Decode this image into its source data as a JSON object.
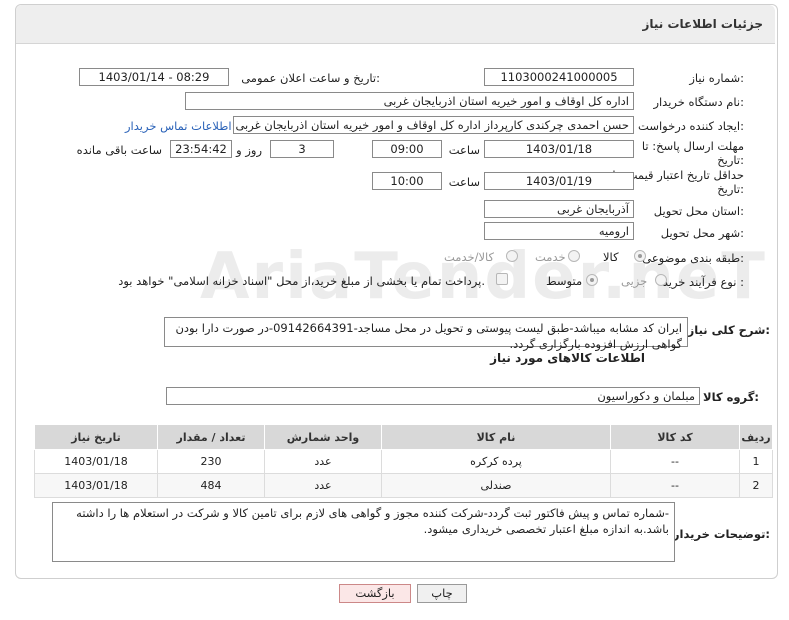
{
  "header": {
    "title": "جزئیات اطلاعات نیاز"
  },
  "fields": {
    "need_number_label": "شماره نیاز:",
    "need_number": "1103000241000005",
    "announce_label": "تاریخ و ساعت اعلان عمومی:",
    "announce_value": "1403/01/14 - 08:29",
    "buyer_org_label": "نام دستگاه خریدار:",
    "buyer_org": "اداره کل اوقاف و امور خیریه استان اذربایجان غربی",
    "creator_label": "ایجاد کننده درخواست:",
    "creator": "حسن احمدی چرکندی کارپرداز اداره کل اوقاف و امور خیریه استان اذربایجان غربی",
    "contact_link": "اطلاعات تماس خریدار",
    "deadline_label_1": "مهلت ارسال پاسخ: تا",
    "deadline_label_2": "تاریخ:",
    "deadline_date": "1403/01/18",
    "time_label": "ساعت",
    "deadline_time": "09:00",
    "days_value": "3",
    "days_label": "روز و",
    "remaining_value": "23:54:42",
    "remaining_label": "ساعت باقی مانده",
    "validity_label_1": "حداقل تاریخ اعتبار قیمت: تا",
    "validity_label_2": "تاریخ:",
    "validity_date": "1403/01/19",
    "validity_time": "10:00",
    "province_label": "استان محل تحویل:",
    "province": "آذربایجان غربی",
    "city_label": "شهر محل تحویل:",
    "city": "ارومیه",
    "category_label": "طبقه بندی موضوعی:",
    "category_options": [
      "کالا",
      "خدمت",
      "کالا/خدمت"
    ],
    "process_label": "نوع فرآیند خرید :",
    "process_options": [
      "جزیی",
      "متوسط"
    ],
    "payment_note": "پرداخت تمام یا بخشی از مبلغ خرید،از محل \"اسناد خزانه اسلامی\" خواهد بود."
  },
  "description": {
    "label": "شرح کلی نیاز:",
    "text": "ایران کد مشابه میباشد-طبق لیست پیوستی و تحویل در محل مساجد-09142664391-در صورت دارا بودن گواهی ارزش افزوده بارگزاری گردد."
  },
  "goods": {
    "section_title": "اطلاعات کالاهای مورد نیاز",
    "group_label": "گروه کالا:",
    "group_value": "مبلمان و دکوراسیون",
    "columns": [
      "ردیف",
      "کد کالا",
      "نام کالا",
      "واحد شمارش",
      "تعداد / مقدار",
      "تاریخ نیاز"
    ],
    "rows": [
      [
        "1",
        "--",
        "پرده کرکره",
        "عدد",
        "230",
        "1403/01/18"
      ],
      [
        "2",
        "--",
        "صندلی",
        "عدد",
        "484",
        "1403/01/18"
      ]
    ]
  },
  "buyer_notes": {
    "label": "توضیحات خریدار:",
    "text": "-شماره تماس و پیش فاکتور ثبت گردد-شرکت کننده مجوز و گواهی های لازم برای تامین کالا و شرکت در استعلام ها را داشته باشد.به اندازه مبلغ اعتبار تخصصی خریداری میشود."
  },
  "buttons": {
    "print": "چاپ",
    "back": "بازگشت"
  },
  "watermark": "AriaTender.neT"
}
